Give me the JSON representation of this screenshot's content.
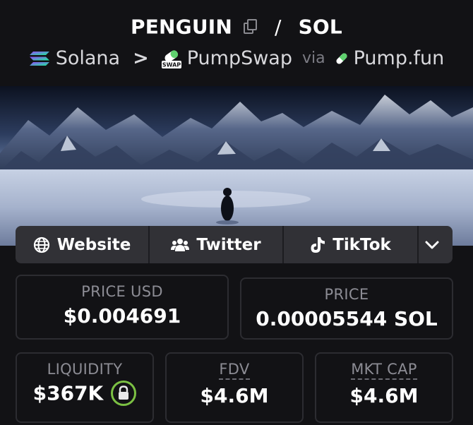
{
  "header": {
    "token": "PENGUIN",
    "separator": "/",
    "quote": "SOL",
    "chain": "Solana",
    "dex": "PumpSwap",
    "via": "via",
    "launchpad": "Pump.fun",
    "swap_badge": "SWAP"
  },
  "socials": {
    "website": "Website",
    "twitter": "Twitter",
    "tiktok": "TikTok"
  },
  "stats": {
    "price_usd_label": "PRICE USD",
    "price_usd_value": "$0.004691",
    "price_label": "PRICE",
    "price_value": "0.00005544 SOL",
    "liquidity_label": "LIQUIDITY",
    "liquidity_value": "$367K",
    "fdv_label": "FDV",
    "fdv_value": "$4.6M",
    "mktcap_label": "MKT CAP",
    "mktcap_value": "$4.6M"
  },
  "colors": {
    "background": "#121215",
    "card_border": "#2c2c31",
    "button_bg": "#313136",
    "lock_green": "#7bc043"
  },
  "icons": [
    "copy-icon",
    "solana-icon",
    "chevron-right-icon",
    "pumpswap-icon",
    "pill-icon",
    "globe-icon",
    "users-icon",
    "tiktok-icon",
    "chevron-down-icon",
    "lock-icon"
  ]
}
